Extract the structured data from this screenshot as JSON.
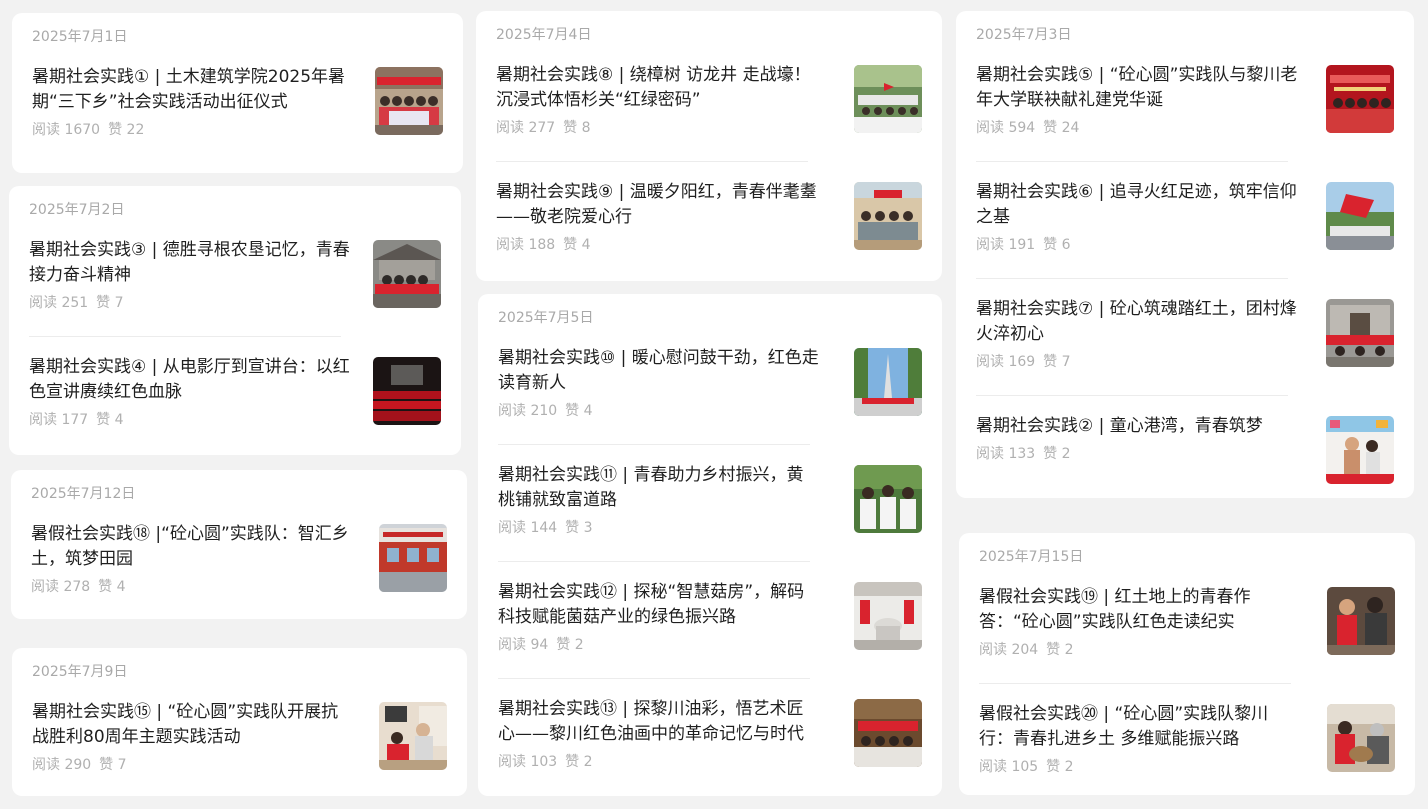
{
  "columns": [
    {
      "cards": [
        {
          "date": "2025年7月1日",
          "items": [
            {
              "title": "暑期社会实践① | 土木建筑学院2025年暑期“三下乡”社会实践活动出征仪式",
              "read": "阅读 1670",
              "like": "赞 22",
              "thumb": "group-photo-banner"
            }
          ]
        },
        {
          "date": "2025年7月2日",
          "items": [
            {
              "title": "暑期社会实践③ | 德胜寻根农垦记忆，青春接力奋斗精神",
              "read": "阅读 251",
              "like": "赞 7",
              "thumb": "group-photo-building"
            },
            {
              "title": "暑期社会实践④ | 从电影厅到宣讲台：以红色宣讲赓续红色血脉",
              "read": "阅读 177",
              "like": "赞 4",
              "thumb": "cinema-hall"
            }
          ]
        },
        {
          "date": "2025年7月12日",
          "items": [
            {
              "title": "暑假社会实践⑱ |“砼心圆”实践队：智汇乡土，筑梦田园",
              "read": "阅读 278",
              "like": "赞 4",
              "thumb": "village-building"
            }
          ]
        },
        {
          "date": "2025年7月9日",
          "items": [
            {
              "title": "暑期社会实践⑮ | “砼心圆”实践队开展抗战胜利80周年主题实践活动",
              "read": "阅读 290",
              "like": "赞 7",
              "thumb": "elder-visit"
            }
          ]
        }
      ]
    },
    {
      "cards": [
        {
          "date": "2025年7月4日",
          "items": [
            {
              "title": "暑期社会实践⑧ | 绕樟树 访龙井 走战壕！沉浸式体悟杉关“红绿密码”",
              "read": "阅读 277",
              "like": "赞 8",
              "thumb": "outdoor-group"
            },
            {
              "title": "暑期社会实践⑨ | 温暖夕阳红，青春伴耄耋——敬老院爱心行",
              "read": "阅读 188",
              "like": "赞 4",
              "thumb": "nursing-home"
            }
          ]
        },
        {
          "date": "2025年7月5日",
          "items": [
            {
              "title": "暑期社会实践⑩ | 暖心慰问鼓干劲，红色走读育新人",
              "read": "阅读 210",
              "like": "赞 4",
              "thumb": "monument"
            },
            {
              "title": "暑期社会实践⑪ | 青春助力乡村振兴，黄桃铺就致富道路",
              "read": "阅读 144",
              "like": "赞 3",
              "thumb": "orchard-group"
            },
            {
              "title": "暑期社会实践⑫ | 探秘“智慧菇房”，解码科技赋能菌菇产业的绿色振兴路",
              "read": "阅读 94",
              "like": "赞 2",
              "thumb": "mushroom-lab"
            },
            {
              "title": "暑期社会实践⑬ | 探黎川油彩，悟艺术匠心——黎川红色油画中的革命记忆与时代传...",
              "read": "阅读 103",
              "like": "赞 2",
              "thumb": "art-gallery"
            }
          ]
        }
      ]
    },
    {
      "cards": [
        {
          "date": "2025年7月3日",
          "items": [
            {
              "title": "暑期社会实践⑤ | “砼心圆”实践队与黎川老年大学联袂献礼建党华诞",
              "read": "阅读 594",
              "like": "赞 24",
              "thumb": "stage-banner"
            },
            {
              "title": "暑期社会实践⑥ | 追寻火红足迹，筑牢信仰之基",
              "read": "阅读 191",
              "like": "赞 6",
              "thumb": "flag-hill"
            },
            {
              "title": "暑期社会实践⑦ | 砼心筑魂踏红土，团村烽火淬初心",
              "read": "阅读 169",
              "like": "赞 7",
              "thumb": "old-house"
            },
            {
              "title": "暑期社会实践② | 童心港湾，青春筑梦",
              "read": "阅读 133",
              "like": "赞 2",
              "thumb": "children-class"
            }
          ]
        },
        {
          "date": "2025年7月15日",
          "items": [
            {
              "title": "暑假社会实践⑲ | 红土地上的青春作答：“砼心圆”实践队红色走读纪实",
              "read": "阅读 204",
              "like": "赞 2",
              "thumb": "red-tour"
            },
            {
              "title": "暑假社会实践⑳ | “砼心圆”实践队黎川行：青春扎进乡土 多维赋能振兴路",
              "read": "阅读 105",
              "like": "赞 2",
              "thumb": "craft-demo"
            }
          ]
        }
      ]
    }
  ],
  "colors": {
    "accent_red": "#d9232e",
    "text": "#1f1f1f",
    "muted": "#b0b0b0",
    "background": "#f2f2f2"
  }
}
